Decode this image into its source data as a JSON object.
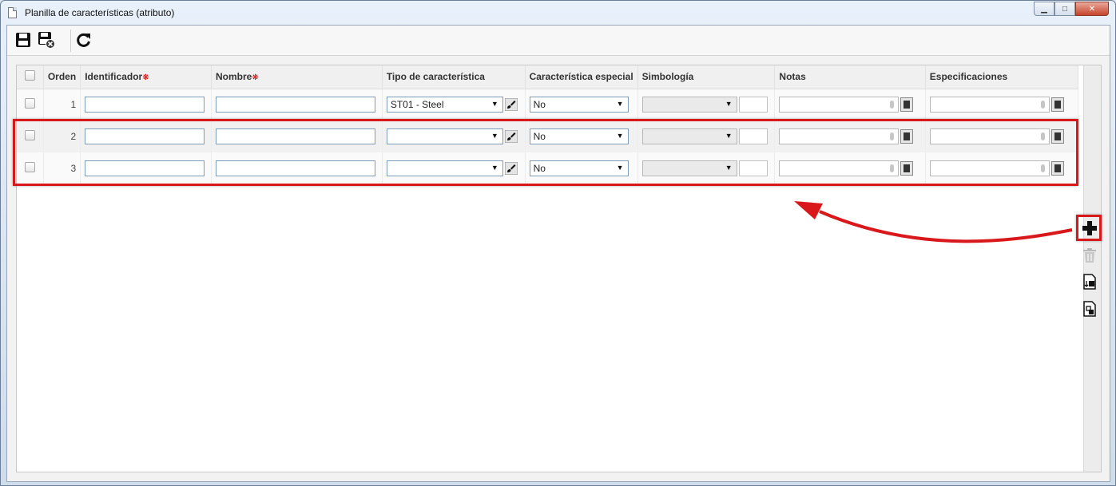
{
  "window": {
    "title": "Planilla de características (atributo)",
    "min_glyph": "▁",
    "max_glyph": "□",
    "close_glyph": "✕"
  },
  "toolbar": {
    "icons": [
      "save-icon",
      "save-close-icon",
      "refresh-icon"
    ]
  },
  "grid": {
    "columns": {
      "orden": "Orden",
      "identificador": "Identificador",
      "nombre": "Nombre",
      "tipo": "Tipo de característica",
      "especial": "Característica especial",
      "simbologia": "Simbología",
      "notas": "Notas",
      "especificaciones": "Especificaciones"
    },
    "required_mark": "❋",
    "rows": [
      {
        "orden": "1",
        "identificador": "",
        "nombre": "",
        "tipo": "ST01 - Steel",
        "especial": "No"
      },
      {
        "orden": "2",
        "identificador": "",
        "nombre": "",
        "tipo": "",
        "especial": "No"
      },
      {
        "orden": "3",
        "identificador": "",
        "nombre": "",
        "tipo": "",
        "especial": "No"
      }
    ]
  },
  "side_toolbar": {
    "icons": [
      "add-icon",
      "delete-icon",
      "import-icon",
      "export-icon"
    ]
  },
  "colors": {
    "highlight": "#d9181c",
    "input_border": "#7f9db9"
  }
}
